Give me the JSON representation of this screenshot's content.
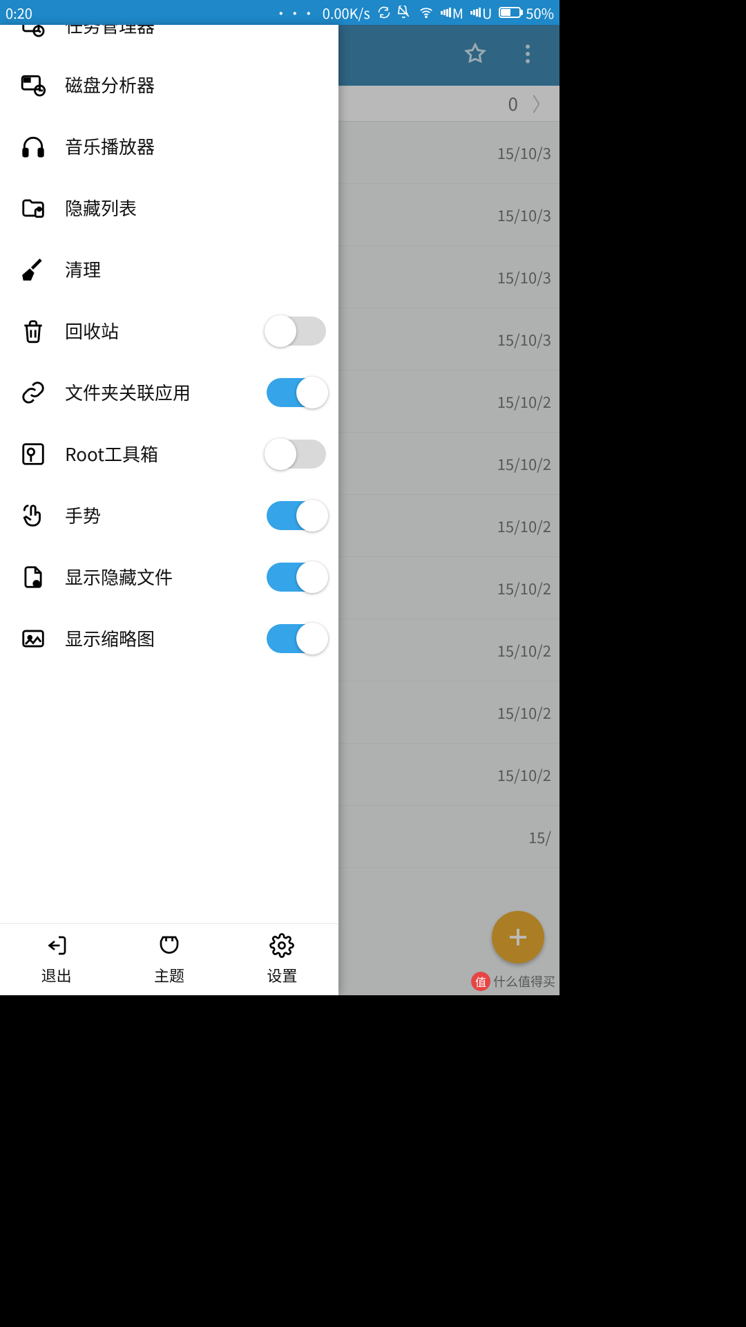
{
  "status": {
    "time": "0:20",
    "speed": "0.00K/s",
    "sim1": "M",
    "sim2": "U",
    "battery_pct": "50%"
  },
  "background": {
    "breadcrumb_tail": "0",
    "file_dates": [
      "15/10/3",
      "15/10/3",
      "15/10/3",
      "15/10/3",
      "15/10/2",
      "15/10/2",
      "15/10/2",
      "15/10/2",
      "15/10/2",
      "15/10/2",
      "15/10/2",
      "15/"
    ]
  },
  "drawer": {
    "items": [
      {
        "label": "任务管理器",
        "icon": "task-manager-icon",
        "toggle": null,
        "cut": true
      },
      {
        "label": "磁盘分析器",
        "icon": "disk-analyzer-icon",
        "toggle": null
      },
      {
        "label": "音乐播放器",
        "icon": "headphones-icon",
        "toggle": null
      },
      {
        "label": "隐藏列表",
        "icon": "hidden-list-icon",
        "toggle": null
      },
      {
        "label": "清理",
        "icon": "broom-icon",
        "toggle": null
      },
      {
        "label": "回收站",
        "icon": "trash-icon",
        "toggle": false
      },
      {
        "label": "文件夹关联应用",
        "icon": "link-icon",
        "toggle": true
      },
      {
        "label": "Root工具箱",
        "icon": "root-toolbox-icon",
        "toggle": false
      },
      {
        "label": "手势",
        "icon": "gesture-icon",
        "toggle": true
      },
      {
        "label": "显示隐藏文件",
        "icon": "show-hidden-files-icon",
        "toggle": true
      },
      {
        "label": "显示缩略图",
        "icon": "thumbnail-icon",
        "toggle": true
      }
    ],
    "bottom": [
      {
        "label": "退出",
        "icon": "exit-icon"
      },
      {
        "label": "主题",
        "icon": "theme-icon"
      },
      {
        "label": "设置",
        "icon": "settings-icon"
      }
    ]
  },
  "watermark": {
    "badge": "值",
    "text": "什么值得买"
  }
}
